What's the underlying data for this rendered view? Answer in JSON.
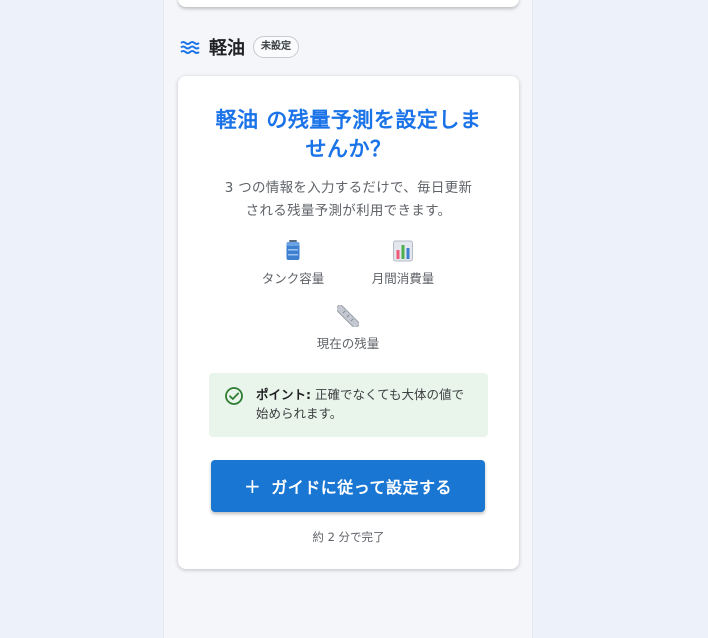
{
  "section": {
    "icon": "waves-icon",
    "title": "軽油",
    "badge": "未設定"
  },
  "card": {
    "title_line1": "軽油 の残量予測を設定しま",
    "title_line2": "せんか？",
    "desc_line1": "3 つの情報を入力するだけで、毎日更新",
    "desc_line2": "される残量予測が利用できます。",
    "features": [
      {
        "icon": "tank-icon",
        "label": "タンク容量"
      },
      {
        "icon": "bar-chart-icon",
        "label": "月間消費量"
      },
      {
        "icon": "ruler-icon",
        "label": "現在の残量"
      }
    ],
    "tip": {
      "icon": "check-circle-icon",
      "label": "ポイント:",
      "text": " 正確でなくても大体の値で始められます。"
    },
    "cta_label": "ガイドに従って設定する",
    "time_note": "約 2 分で完了"
  },
  "colors": {
    "accent": "#1a73e8",
    "button": "#1976d2",
    "tip_bg": "#e9f4ea",
    "tip_icon": "#2e7d32"
  }
}
